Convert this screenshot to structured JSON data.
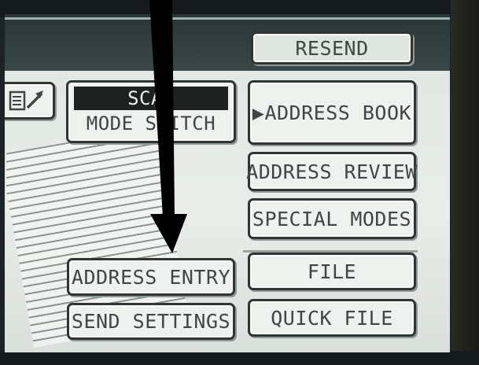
{
  "panel": {
    "resend": "RESEND",
    "scan": "SCAN",
    "mode_switch": "MODE SWITCH",
    "address_book": "▶ADDRESS BOOK",
    "address_review": "ADDRESS REVIEW",
    "special_modes": "SPECIAL MODES",
    "file": "FILE",
    "address_entry": "ADDRESS ENTRY",
    "quick_file": "QUICK FILE",
    "send_settings": "SEND SETTINGS"
  },
  "icons": {
    "preview": "document-arrow-icon",
    "pointer": "arrow-annotation-icon"
  },
  "colors": {
    "screen_bg": "#e5eae6",
    "button_border": "#2f3533",
    "button_text": "#3e4743",
    "scan_highlight": "#1d2221",
    "arrow": "#000000"
  }
}
